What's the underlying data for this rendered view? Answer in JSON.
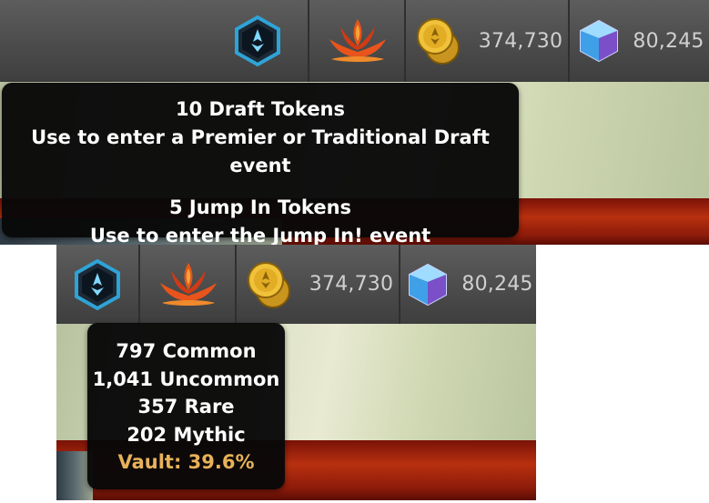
{
  "top_panel": {
    "currency": {
      "gold": "374,730",
      "gems": "80,245"
    },
    "tooltip": {
      "lines": [
        "10 Draft Tokens",
        "Use to enter a Premier or Traditional Draft event",
        "5 Jump In Tokens",
        "Use to enter the Jump In! event"
      ]
    }
  },
  "bottom_panel": {
    "currency": {
      "gold": "374,730",
      "gems": "80,245"
    },
    "tooltip": {
      "lines": [
        "797 Common",
        "1,041 Uncommon",
        "357 Rare",
        "202 Mythic"
      ],
      "vault": "Vault: 39.6%"
    }
  },
  "icons": [
    "mastery-pass-icon",
    "wildcard-lotus-icon",
    "gold-coins-icon",
    "gem-icon"
  ],
  "colors": {
    "topbar": "#4a4a4a",
    "tooltip_bg": "#080808",
    "vault_text": "#e7b25a",
    "currency_text": "#d0d0d0"
  }
}
